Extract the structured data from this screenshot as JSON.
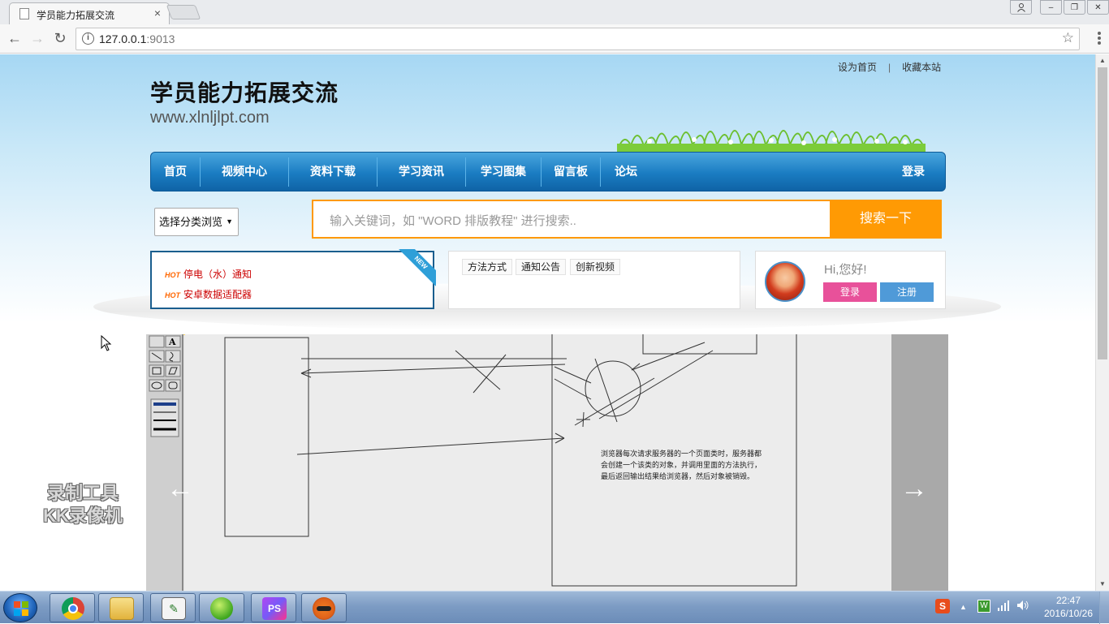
{
  "browser": {
    "tab_title": "学员能力拓展交流",
    "tab_close": "×",
    "url_host": "127.0.0.1",
    "url_port": ":9013",
    "star": "☆",
    "back": "←",
    "forward": "→",
    "reload": "↻",
    "info": "i"
  },
  "window": {
    "user_icon": "user-icon",
    "minimize": "–",
    "restore": "❐",
    "close": "✕"
  },
  "site": {
    "toplinks": [
      "设为首页",
      "收藏本站"
    ],
    "toplinks_sep": "|",
    "title": "学员能力拓展交流",
    "url": "www.xlnljlpt.com"
  },
  "nav": {
    "items": [
      "首页",
      "视频中心",
      "资料下载",
      "学习资讯",
      "学习图集",
      "留言板",
      "论坛"
    ],
    "login": "登录"
  },
  "search": {
    "category": "选择分类浏览",
    "category_arrow": "▼",
    "placeholder": "输入关键词，如 \"WORD 排版教程\" 进行搜索..",
    "button": "搜索一下"
  },
  "notice": {
    "ribbon": "NEW",
    "hot_label": "HOT",
    "items": [
      "停电（水）通知",
      "安卓数据适配器"
    ]
  },
  "tabs": [
    "方法方式",
    "通知公告",
    "创新视频"
  ],
  "user": {
    "greeting": "Hi,您好!",
    "login": "登录",
    "register": "注册",
    "login_color": "#e8519a",
    "register_color": "#4f9ad8"
  },
  "slider": {
    "prev": "←",
    "next": "→",
    "caption": "浏览器每次请求服务器的一个页面类时，服务器都会创建一个该类的对象，并调用里面的方法执行，最后返回输出结果给浏览器，然后对象被销毁。"
  },
  "watermark": [
    "录制工具",
    "KK录像机"
  ],
  "taskbar": {
    "apps": [
      {
        "name": "chrome-icon",
        "label": ""
      },
      {
        "name": "file-explorer-icon",
        "label": ""
      },
      {
        "name": "editor-icon",
        "label": ""
      },
      {
        "name": "green-app-icon",
        "label": ""
      },
      {
        "name": "phpstorm-icon",
        "label": "PS"
      },
      {
        "name": "ninja-app-icon",
        "label": ""
      }
    ],
    "time": "22:47",
    "date": "2016/10/26",
    "sogou": "S",
    "tray_up": "▲",
    "tray_green": "W"
  },
  "colors": {
    "nav_blue": "#1a7cc2",
    "search_orange": "#ff9a04",
    "notice_border": "#1a5e8e",
    "hot_orange": "#ff6600",
    "notice_red": "#cc0000"
  }
}
